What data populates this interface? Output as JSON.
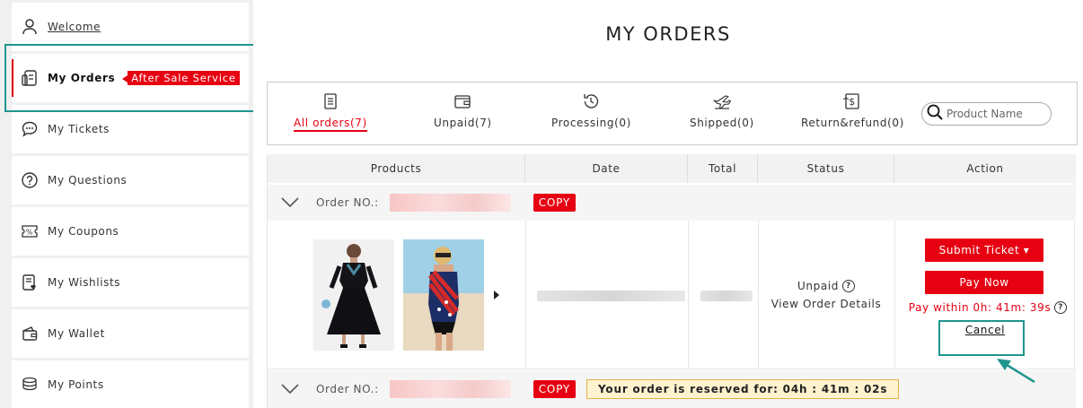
{
  "sidebar": {
    "welcome": "Welcome",
    "items": [
      {
        "label": "My Orders",
        "badge": "After Sale Service"
      },
      {
        "label": "My Tickets"
      },
      {
        "label": "My Questions"
      },
      {
        "label": "My Coupons"
      },
      {
        "label": "My Wishlists"
      },
      {
        "label": "My Wallet"
      },
      {
        "label": "My Points"
      }
    ]
  },
  "main": {
    "title": "MY ORDERS",
    "tabs": [
      {
        "label": "All orders(7)",
        "icon": "document-icon"
      },
      {
        "label": "Unpaid(7)",
        "icon": "wallet-icon"
      },
      {
        "label": "Processing(0)",
        "icon": "history-icon"
      },
      {
        "label": "Shipped(0)",
        "icon": "airplane-icon"
      },
      {
        "label": "Return&refund(0)",
        "icon": "dollar-doc-icon"
      }
    ],
    "search": {
      "placeholder": "Product Name"
    },
    "table": {
      "columns": [
        "Products",
        "Date",
        "Total",
        "Status",
        "Action"
      ],
      "order_label": "Order NO.:",
      "copy_label": "COPY",
      "status": "Unpaid",
      "view_details": "View Order Details",
      "submit_ticket": "Submit Ticket ▾",
      "pay_now": "Pay Now",
      "pay_within": "Pay within 0h: 41m: 39s",
      "cancel": "Cancel",
      "reserved": "Your order is reserved for:  04h :  41m :  02s"
    }
  },
  "colors": {
    "accent": "#e60012",
    "highlight": "#1f958f"
  }
}
